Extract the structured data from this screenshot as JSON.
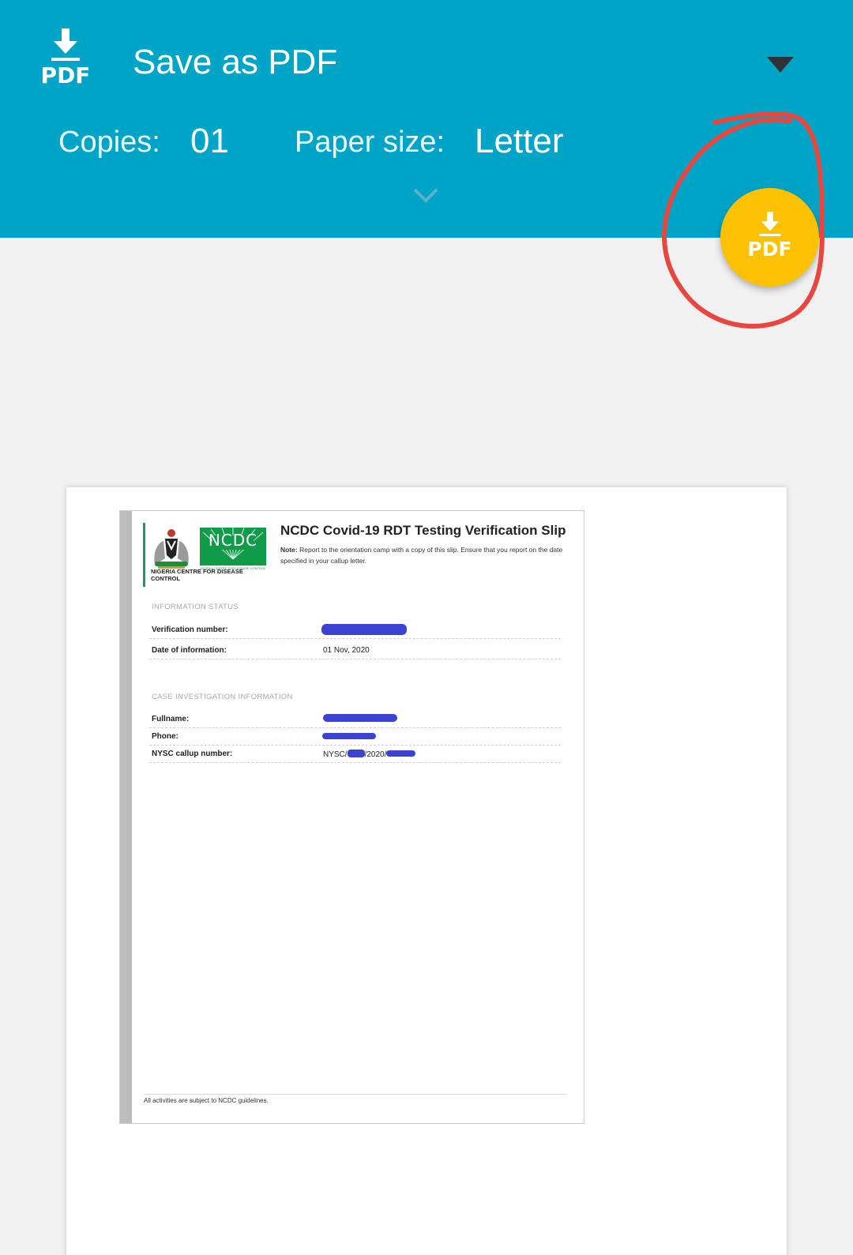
{
  "header": {
    "printer_name": "Save as PDF",
    "pdf_icon_label": "PDF",
    "copies_label": "Copies:",
    "copies_value": "01",
    "paper_size_label": "Paper size:",
    "paper_size_value": "Letter"
  },
  "fab": {
    "label": "PDF"
  },
  "colors": {
    "toolbar": "#00a4c6",
    "fab": "#fbc102",
    "annotation": "#e8473f",
    "redaction": "#3b43d0"
  },
  "slip": {
    "org_name": "NIGERIA CENTRE FOR DISEASE CONTROL",
    "logo_text": "NCDC",
    "logo_subtext": "NIGERIA CENTRE FOR DISEASE CONTROL",
    "title": "NCDC Covid-19 RDT Testing Verification Slip",
    "note_label": "Note:",
    "note_text": "Report to the orientation camp with a copy of this slip. Ensure that you report on the date specified in your callup letter.",
    "section_status": "INFORMATION STATUS",
    "verification_label": "Verification number:",
    "date_label": "Date of information:",
    "date_value": "01 Nov, 2020",
    "section_case": "CASE INVESTIGATION INFORMATION",
    "fullname_label": "Fullname:",
    "phone_label": "Phone:",
    "callup_label": "NYSC callup number:",
    "callup_prefix": "NYSC/",
    "callup_middle": "/2020/",
    "footer": "All activities are subject to NCDC guidelines."
  }
}
